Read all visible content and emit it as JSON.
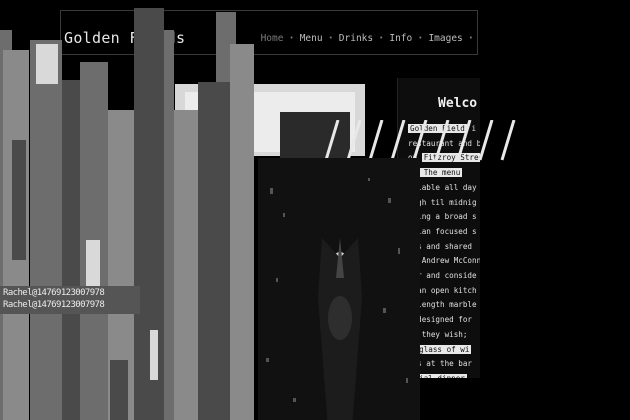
{
  "site": {
    "title": "Golden Fields"
  },
  "nav": {
    "items": [
      {
        "label": "Home",
        "active": true
      },
      {
        "label": "Menu",
        "active": false
      },
      {
        "label": "Drinks",
        "active": false
      },
      {
        "label": "Info",
        "active": false
      },
      {
        "label": "Images",
        "active": false
      }
    ],
    "separator": "•"
  },
  "welcome": {
    "heading": "Welco",
    "lines": [
      {
        "pre": "",
        "hl": "Golden Field",
        "post": " i"
      },
      {
        "pre": "restaurant and bar",
        "hl": "",
        "post": ""
      },
      {
        "pre": "on ",
        "hl": "Fitzroy Stree",
        "post": ""
      },
      {
        "pre": "",
        "hl": "d. The menu",
        "post": ""
      },
      {
        "pre": "ailable all day",
        "hl": "",
        "post": ""
      },
      {
        "pre": "ough til midnig",
        "hl": "",
        "post": ""
      },
      {
        "pre": "ering a broad s",
        "hl": "",
        "post": ""
      },
      {
        "pre": "Asian focused s",
        "hl": "",
        "post": ""
      },
      {
        "pre": "tes and shared",
        "hl": "",
        "post": ""
      },
      {
        "pre": "of Andrew McConn",
        "hl": "",
        "post": ""
      },
      {
        "pre": "ver and conside",
        "hl": "",
        "post": ""
      },
      {
        "pre": "h an open kitch",
        "hl": "",
        "post": ""
      },
      {
        "pre": "l length marble",
        "hl": "",
        "post": ""
      },
      {
        "pre": "n designed for",
        "hl": "",
        "post": ""
      },
      {
        "pre": " as they wish;",
        "hl": "",
        "post": ""
      },
      {
        "pre": "",
        "hl": "a glass of wi",
        "post": ""
      },
      {
        "pre": "cks at the bar",
        "hl": "",
        "post": ""
      },
      {
        "pre": "",
        "hl": "ecial dinner",
        "post": ""
      },
      {
        "pre": "ends, you are",
        "hl": "",
        "post": ""
      }
    ]
  },
  "contact": {
    "phone_line": "Rachel@14769123007978"
  }
}
